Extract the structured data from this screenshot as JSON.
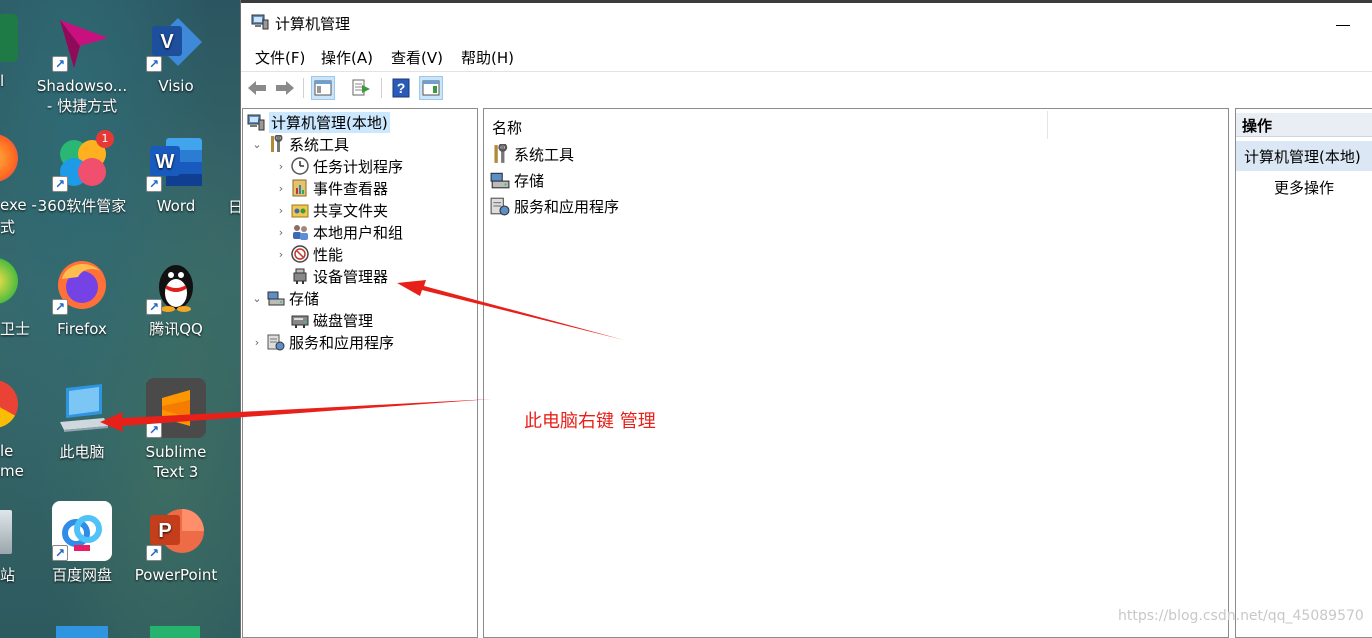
{
  "desktop": {
    "partial_labels": [
      "l",
      "exe -",
      "式",
      "卫士",
      "le",
      "me",
      "站",
      "日"
    ],
    "icons": [
      {
        "label_lines": [
          "Shadowso...",
          "- 快捷方式"
        ],
        "icon": "paper-plane-icon",
        "color": "#c8107e"
      },
      {
        "label_lines": [
          "Visio"
        ],
        "icon": "visio-icon",
        "color": "#2b5fb4"
      },
      {
        "label_lines": [
          "360软件管家"
        ],
        "icon": "360-software-icon",
        "color": "#27b36b",
        "badge": "1"
      },
      {
        "label_lines": [
          "Word"
        ],
        "icon": "word-icon",
        "color": "#2b579a"
      },
      {
        "label_lines": [
          "Firefox"
        ],
        "icon": "firefox-icon",
        "color": "#ff6a1f"
      },
      {
        "label_lines": [
          "腾讯QQ"
        ],
        "icon": "qq-penguin-icon",
        "color": "#111111"
      },
      {
        "label_lines": [
          "此电脑"
        ],
        "icon": "this-pc-icon",
        "color": "#4fa8e8"
      },
      {
        "label_lines": [
          "Sublime",
          "Text 3"
        ],
        "icon": "sublime-icon",
        "color": "#ff9800"
      },
      {
        "label_lines": [
          "百度网盘"
        ],
        "icon": "baidu-netdisk-icon",
        "color": "#2f8ce8"
      },
      {
        "label_lines": [
          "PowerPoint"
        ],
        "icon": "powerpoint-icon",
        "color": "#d24726"
      }
    ]
  },
  "window": {
    "title": "计算机管理",
    "menu": [
      "文件(F)",
      "操作(A)",
      "查看(V)",
      "帮助(H)"
    ],
    "toolbar": [
      "back-arrow-icon",
      "forward-arrow-icon",
      "show-tree-icon",
      "export-list-icon",
      "help-icon",
      "show-action-pane-icon"
    ],
    "tree": [
      {
        "label": "计算机管理(本地)",
        "level": 0,
        "chevron": "",
        "icon": "computer-management-icon",
        "selected": true
      },
      {
        "label": "系统工具",
        "level": 1,
        "chevron": "⌄",
        "icon": "system-tools-icon"
      },
      {
        "label": "任务计划程序",
        "level": 2,
        "chevron": "›",
        "icon": "task-scheduler-icon"
      },
      {
        "label": "事件查看器",
        "level": 2,
        "chevron": "›",
        "icon": "event-viewer-icon"
      },
      {
        "label": "共享文件夹",
        "level": 2,
        "chevron": "›",
        "icon": "shared-folders-icon"
      },
      {
        "label": "本地用户和组",
        "level": 2,
        "chevron": "›",
        "icon": "local-users-icon"
      },
      {
        "label": "性能",
        "level": 2,
        "chevron": "›",
        "icon": "performance-icon"
      },
      {
        "label": "设备管理器",
        "level": 2,
        "chevron": "",
        "icon": "device-manager-icon"
      },
      {
        "label": "存储",
        "level": 1,
        "chevron": "⌄",
        "icon": "storage-icon"
      },
      {
        "label": "磁盘管理",
        "level": 2,
        "chevron": "",
        "icon": "disk-management-icon"
      },
      {
        "label": "服务和应用程序",
        "level": 1,
        "chevron": "›",
        "icon": "services-apps-icon"
      }
    ],
    "list": {
      "column_name": "名称",
      "items": [
        {
          "label": "系统工具",
          "icon": "system-tools-icon"
        },
        {
          "label": "存储",
          "icon": "storage-icon"
        },
        {
          "label": "服务和应用程序",
          "icon": "services-apps-icon"
        }
      ]
    },
    "actions": {
      "header": "操作",
      "section": "计算机管理(本地)",
      "more": "更多操作"
    }
  },
  "annotation": {
    "text": "此电脑右键 管理",
    "color": "#e8201a"
  },
  "watermark": "https://blog.csdn.net/qq_45089570"
}
